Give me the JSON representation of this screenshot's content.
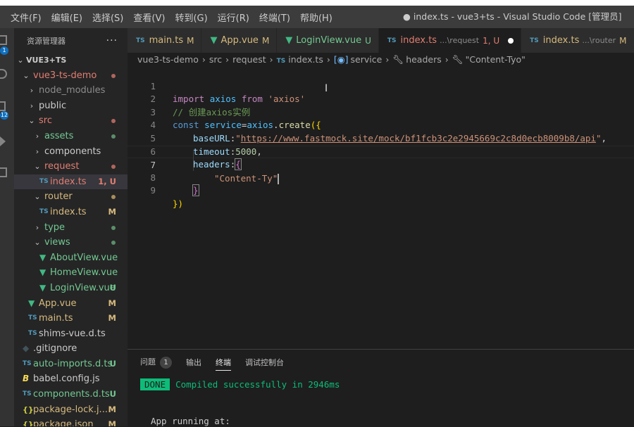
{
  "titlebar": {
    "menu": [
      "文件(F)",
      "编辑(E)",
      "选择(S)",
      "查看(V)",
      "转到(G)",
      "运行(R)",
      "终端(T)",
      "帮助(H)"
    ],
    "title": "● index.ts - vue3+ts - Visual Studio Code [管理员]"
  },
  "activity": {
    "badge_explorer": "1",
    "badge_scm": "12"
  },
  "sidebar": {
    "title": "资源管理器",
    "more": "···",
    "project": "VUE3+TS",
    "tree": [
      {
        "label": "vue3-ts-demo",
        "chev": "⌄",
        "color": "c-red",
        "deco": "dot-red"
      },
      {
        "label": "node_modules",
        "chev": "›",
        "color": "c-gray"
      },
      {
        "label": "public",
        "chev": "›",
        "color": "c-normal"
      },
      {
        "label": "src",
        "chev": "⌄",
        "color": "c-red",
        "deco": "dot-red"
      },
      {
        "label": "assets",
        "chev": "›",
        "color": "c-green",
        "deco": "dot-green"
      },
      {
        "label": "components",
        "chev": "›",
        "color": "c-normal"
      },
      {
        "label": "request",
        "chev": "⌄",
        "color": "c-red",
        "deco": "dot-red"
      },
      {
        "label": "index.ts",
        "icon": "TS",
        "color": "c-red",
        "deco": "1, U",
        "selected": true
      },
      {
        "label": "router",
        "chev": "⌄",
        "color": "c-yellow",
        "deco": "dot-yellow"
      },
      {
        "label": "index.ts",
        "icon": "TS",
        "color": "c-yellow",
        "deco": "M"
      },
      {
        "label": "type",
        "chev": "›",
        "color": "c-green",
        "deco": "dot-green"
      },
      {
        "label": "views",
        "chev": "⌄",
        "color": "c-green",
        "deco": "dot-green"
      },
      {
        "label": "AboutView.vue",
        "icon": "V",
        "color": "c-green"
      },
      {
        "label": "HomeView.vue",
        "icon": "V",
        "color": "c-green"
      },
      {
        "label": "LoginView.vue",
        "icon": "V",
        "color": "c-green",
        "deco": "U"
      },
      {
        "label": "App.vue",
        "icon": "V",
        "color": "c-yellow",
        "deco": "M"
      },
      {
        "label": "main.ts",
        "icon": "TS",
        "color": "c-yellow",
        "deco": "M"
      },
      {
        "label": "shims-vue.d.ts",
        "icon": "TS",
        "color": "c-normal"
      },
      {
        "label": ".gitignore",
        "icon": "git",
        "color": "c-normal"
      },
      {
        "label": "auto-imports.d.ts",
        "icon": "TS",
        "color": "c-green",
        "deco": "U"
      },
      {
        "label": "babel.config.js",
        "icon": "B",
        "color": "c-normal"
      },
      {
        "label": "components.d.ts",
        "icon": "TS",
        "color": "c-green",
        "deco": "U"
      },
      {
        "label": "package-lock.j...",
        "icon": "{}",
        "color": "c-yellow",
        "deco": "M"
      },
      {
        "label": "package.json",
        "icon": "{}",
        "color": "c-yellow",
        "deco": "M"
      }
    ]
  },
  "tabs": [
    {
      "icon": "TS",
      "label": "main.ts",
      "deco": "M",
      "color": "c-yellow"
    },
    {
      "icon": "V",
      "label": "App.vue",
      "deco": "M",
      "color": "c-yellow"
    },
    {
      "icon": "V",
      "label": "LoginView.vue",
      "deco": "U",
      "color": "c-green"
    },
    {
      "icon": "TS",
      "label": "index.ts",
      "desc": "...\\request",
      "deco": "1, U",
      "color": "c-red",
      "active": true
    },
    {
      "icon": "TS",
      "label": "index.ts",
      "desc": "...\\router",
      "deco": "M",
      "color": "c-yellow"
    }
  ],
  "breadcrumb": {
    "items": [
      "vue3-ts-demo",
      "src",
      "request",
      "index.ts",
      "service",
      "headers",
      "\"Content-Tyo\""
    ]
  },
  "editor": {
    "current_line": 7,
    "lines": [
      {
        "num": "1"
      },
      {
        "num": "2"
      },
      {
        "num": "3"
      },
      {
        "num": "4"
      },
      {
        "num": "5"
      },
      {
        "num": "6"
      },
      {
        "num": "7"
      },
      {
        "num": "8"
      },
      {
        "num": "9"
      }
    ],
    "code": {
      "l1": {
        "import": "import",
        "name": "axios",
        "from": "from",
        "src": "'axios'"
      },
      "l2": {
        "comment": "// 创建axios实例"
      },
      "l3": {
        "const": "const",
        "name": "service",
        "eq": "=",
        "obj": "axios",
        "dot": ".",
        "fn": "create",
        "open": "({"
      },
      "l4": {
        "key": "baseURL",
        "colon": ":",
        "q1": "\"",
        "url": "https://www.fastmock.site/mock/bf1fcb3c2e2945669c2c8d0ecb8009b8/api",
        "q2": "\"",
        "comma": ","
      },
      "l5": {
        "key": "timeout",
        "colon": ":",
        "val": "5000",
        "comma": ","
      },
      "l6": {
        "key": "headers",
        "colon": ":",
        "open": "{"
      },
      "l7": {
        "str": "\"Content-Ty\""
      },
      "l8": {
        "close": "}"
      },
      "l9": {
        "close": "})"
      }
    }
  },
  "panel": {
    "tabs": [
      "问题",
      "输出",
      "终端",
      "调试控制台"
    ],
    "problems_count": "1",
    "active_tab": "终端",
    "terminal": {
      "done": "DONE",
      "message": "Compiled successfully in 2946ms",
      "app_running": "App running at:"
    }
  }
}
